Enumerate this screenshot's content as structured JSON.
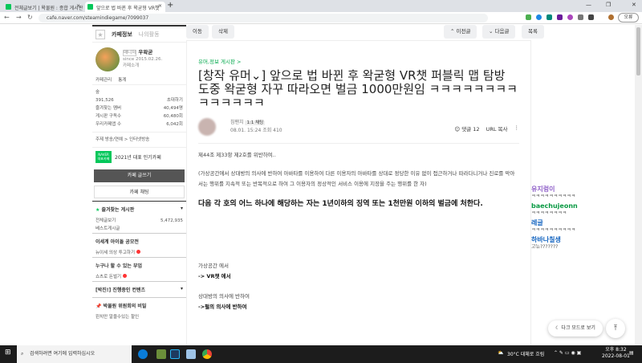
{
  "browser": {
    "tabs": [
      {
        "label": "전체글보기 | 왁물원 : 종합 게시판",
        "close": "×"
      },
      {
        "label": "앞으로 법 바뀐 후 왁굳형 VR챗",
        "close": "×"
      }
    ],
    "new_tab": "+",
    "url": "cafe.naver.com/steamindiegame/7099037",
    "profile": "오류"
  },
  "sidebar": {
    "tabs": [
      "카페정보",
      "나의활동"
    ],
    "cafe_badge": "매니저",
    "cafe_manager": "우왁굳",
    "since": "since 2015.02.26.",
    "intro": "카페소개",
    "links": [
      "카페관리",
      "통계"
    ],
    "grade": "숲",
    "members": "391,526",
    "invite": "초대하기",
    "stats": [
      {
        "label": "즐겨찾는 멤버",
        "value": "40,494명"
      },
      {
        "label": "게시판 구독수",
        "value": "60,480회"
      },
      {
        "label": "우리카페앱 수",
        "value": "6,042회"
      }
    ],
    "theme": "주제 방송/연예 > 인터넷방송",
    "award_badge": "NAVER 대표카페",
    "award": "2021년 대표 인기카페",
    "write": "카페 글쓰기",
    "chat": "카페 채팅",
    "fav_boards": "즐겨찾는 게시판",
    "all_posts": "전체글보기",
    "all_count": "5,472,935",
    "best": "베스트게시글",
    "sec2": "이세계 아이돌 공모전",
    "sec2_item": "뉴이세 의상 투고하기",
    "sec3": "누구나 할 수 있는 부업",
    "sec3_item": "쇼츠로 돈벌기",
    "sec4": "[박진!] 진행중인 컨텐츠",
    "sec5": "박물원 위원회의 비밀",
    "sec5_item": "왼치만 알을수있는 할인"
  },
  "toolbar": {
    "move": "이동",
    "delete": "삭제",
    "prev": "이전글",
    "next": "다음글",
    "list": "목록"
  },
  "article": {
    "board": "유머,정보 게시판 >",
    "title": "[창작 유머⌄] 앞으로 법 바뀐 후 왁굳형 VR챗 퍼블릭 맵 탐방 도중 왁굳형 자꾸 따라오면 벌금 1000만원임 ㅋㅋㅋㅋㅋㅋㅋㅋㅋㅋㅋㅋㅋㅋ",
    "author": "침팬치",
    "chat_badge": "1:1 채팅",
    "date": "08.01. 15:24",
    "views": "조회 410",
    "comments": "댓글 12",
    "url_copy": "URL 복사",
    "paragraphs": [
      "제44조 제33항 제2호를 위반하여..",
      "(가상공간에서 상대방의 의사에 반하여 아바타를 이용하여 다른 이용자의 아바타를 상대로 정당한 이유 없이 접근하거나 따라다니거나 진로를 막아서는 행위를 지속적 또는 반복적으로 하여 그 이용자의 정상적인 서비스 이용에 지장을 주는 행위를 한 자)",
      "다음 각 호의 어느 하나에 해당하는 자는 1년이하의 징역 또는 1천만원 이하의 벌금에 처한다.",
      "가상공간 에서",
      "-> VR챗 에서",
      "상대방의 의사에 반하여",
      "->펄의 의사에 반하여"
    ]
  },
  "chat": [
    {
      "name": "유지렁이",
      "msg": "ㅋㅋㅋㅋㅋㅋㅋㅋㅋㅋ",
      "color": "#8e5ec8"
    },
    {
      "name": "baechujeonn",
      "msg": "ㅋㅋㅋㅋㅋㅋㅋㅋ",
      "color": "#0b9a44"
    },
    {
      "name": "레글",
      "msg": "ㅋㅋㅋㅋㅋㅋㅋㅋㅋㅋ",
      "color": "#1565c0"
    },
    {
      "name": "하바나칠생",
      "msg": "고뉴???????",
      "color": "#1565c0"
    }
  ],
  "dark_mode": "다크 모드로 보기",
  "taskbar": {
    "search": "검색하려면 여기에 입력하십시오",
    "weather": "30°C 대체로 흐림",
    "time": "오후 8:32",
    "date": "2022-08-01"
  }
}
